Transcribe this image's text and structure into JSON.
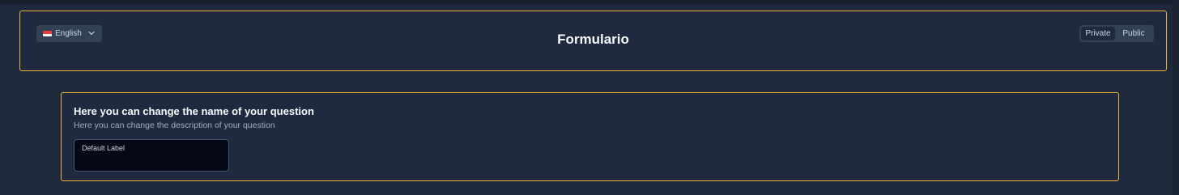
{
  "header": {
    "language_label": "English",
    "language_icon": "flag-icon",
    "title": "Formulario",
    "visibility": {
      "private_label": "Private",
      "public_label": "Public",
      "selected": "Private"
    }
  },
  "question": {
    "title": "Here you can change the name of your question",
    "description": "Here you can change the description of your question",
    "field_label": "Default Label"
  },
  "colors": {
    "background": "#1e293b",
    "card_border": "#f2b13a",
    "input_background": "#050816"
  }
}
